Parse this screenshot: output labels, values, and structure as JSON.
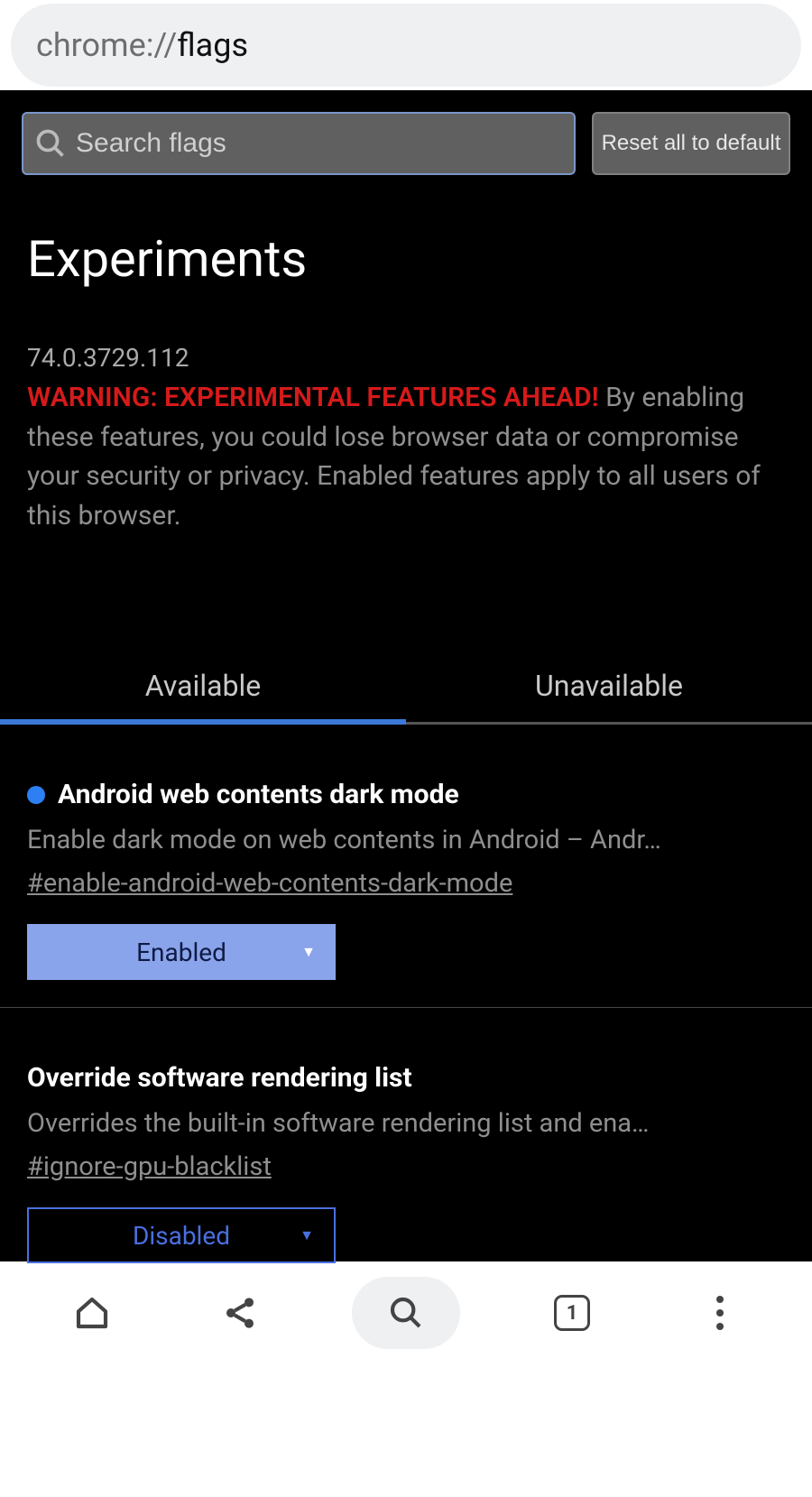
{
  "address": {
    "prefix": "chrome://",
    "path": "flags"
  },
  "search": {
    "placeholder": "Search flags"
  },
  "reset_button": "Reset all to default",
  "title": "Experiments",
  "version": "74.0.3729.112",
  "warning_label": "WARNING: EXPERIMENTAL FEATURES AHEAD!",
  "warning_text": " By enabling these features, you could lose browser data or compromise your security or privacy. Enabled features apply to all users of this browser.",
  "tabs": {
    "available": "Available",
    "unavailable": "Unavailable"
  },
  "flags": [
    {
      "title": "Android web contents dark mode",
      "desc": "Enable dark mode on web contents in Android – Andr…",
      "hash": "#enable-android-web-contents-dark-mode",
      "value": "Enabled",
      "modified": true
    },
    {
      "title": "Override software rendering list",
      "desc": "Overrides the built-in software rendering list and ena…",
      "hash": "#ignore-gpu-blacklist",
      "value": "Disabled",
      "modified": false
    }
  ],
  "bottom": {
    "tab_count": "1"
  }
}
